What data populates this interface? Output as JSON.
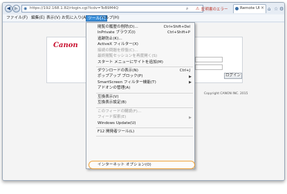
{
  "browser": {
    "address_url": "https://192.168.1.82/rlogin.cgi?lcdv=ToB9M4Q",
    "cert_warning": "証明書のエラー",
    "tab_title": "Remote UI",
    "icons": {
      "back": "back-arrow-icon",
      "forward": "forward-arrow-icon",
      "search": "magnifier-icon",
      "cert": "cert-warning-icon",
      "home": "home-icon",
      "favorites": "star-icon",
      "tools": "gear-icon"
    }
  },
  "menubar": {
    "items": [
      {
        "label": "ファイル(F)"
      },
      {
        "label": "編集(E)"
      },
      {
        "label": "表示(V)"
      },
      {
        "label": "お気に入り(A)"
      },
      {
        "label": "ツール(T)"
      },
      {
        "label": "ヘルプ(H)"
      }
    ]
  },
  "tools_menu": {
    "items": [
      {
        "label": "閲覧の履歴の削除(D)...",
        "shortcut": "Ctrl+Shift+Del"
      },
      {
        "label": "InPrivate ブラウズ(I)",
        "shortcut": "Ctrl+Shift+P"
      },
      {
        "label": "追跡防止(K)..."
      },
      {
        "label": "ActiveX フィルター(X)"
      },
      {
        "label": "接続の問題を修復(C)...",
        "disabled": true
      },
      {
        "label": "最終閲覧セッションを再度開く(S)",
        "disabled": true
      },
      {
        "label": "スタート メニューにサイトを追加(M)"
      },
      {
        "label": "ダウンロードの表示(N)",
        "shortcut": "Ctrl+J"
      },
      {
        "label": "ポップアップ ブロック(P)",
        "submenu": true
      },
      {
        "label": "SmartScreen フィルター機能(T)",
        "submenu": true
      },
      {
        "label": "アドオンの管理(A)"
      },
      {
        "label": "互換表示(V)"
      },
      {
        "label": "互換表示設定(B)"
      },
      {
        "label": "このフィードの購読(F)...",
        "disabled": true
      },
      {
        "label": "フィード探索(E)",
        "disabled": true,
        "submenu": true
      },
      {
        "label": "Windows Update(U)"
      },
      {
        "label": "F12 開発者ツール(L)"
      },
      {
        "label": "インターネット オプション(O)"
      }
    ]
  },
  "page": {
    "logo_text": "Canon",
    "login_button": "ログイン",
    "copyright": "Copyright CANON INC. 2015"
  },
  "colors": {
    "menu_active": "#3b8fd9",
    "highlight_ring": "#f0a33a",
    "canon_red": "#c8102e"
  }
}
